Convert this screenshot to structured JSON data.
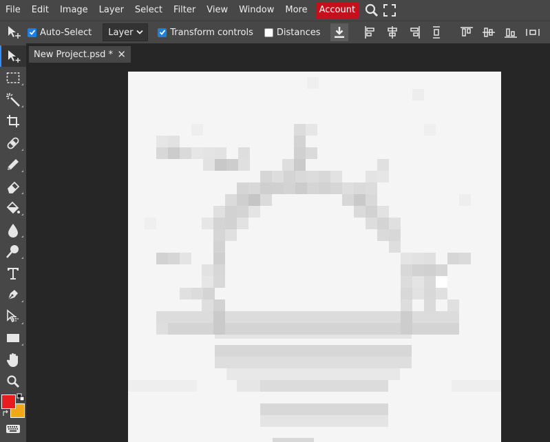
{
  "menu": {
    "items": [
      "File",
      "Edit",
      "Image",
      "Layer",
      "Select",
      "Filter",
      "View",
      "Window",
      "More"
    ],
    "account_label": "Account",
    "icons": [
      "search-icon",
      "fullscreen-icon"
    ]
  },
  "options": {
    "auto_select_label": "Auto-Select",
    "auto_select_checked": true,
    "layer_select_value": "Layer",
    "transform_controls_label": "Transform controls",
    "transform_controls_checked": true,
    "distances_label": "Distances",
    "distances_checked": false
  },
  "tab": {
    "title": "New Project.psd *",
    "close_glyph": "✕"
  },
  "tools": [
    "move-tool",
    "marquee-tool",
    "magic-wand-tool",
    "crop-tool",
    "healing-tool",
    "brush-tool",
    "eraser-tool",
    "paint-bucket-tool",
    "blur-tool",
    "dodge-tool",
    "type-tool",
    "pen-tool",
    "path-select-tool",
    "rectangle-tool",
    "hand-tool",
    "zoom-tool"
  ],
  "colors": {
    "foreground": "#e81c1c",
    "background": "#f0a818",
    "accent": "#1e7fe0",
    "account": "#c4101a"
  }
}
